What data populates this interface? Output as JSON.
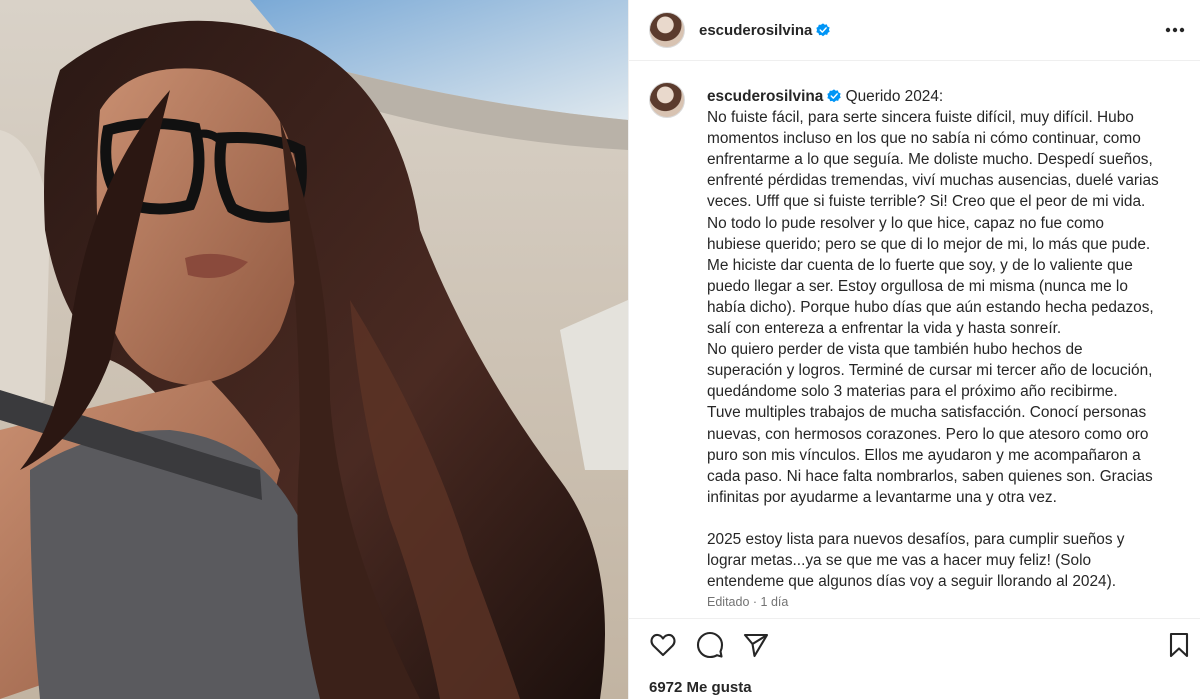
{
  "post": {
    "username": "escuderosilvina",
    "verified": true,
    "caption_lead": "Querido 2024:",
    "caption_body": "No fuiste fácil, para serte sincera fuiste difícil, muy difícil. Hubo\nmomentos incluso en los que no sabía ni cómo continuar, como\nenfrentarme a lo que seguía. Me doliste mucho. Despedí sueños,\nenfrenté pérdidas tremendas, viví muchas ausencias, duelé varias\nveces. Ufff que si fuiste terrible? Si! Creo que el peor de mi vida.\nNo todo lo pude resolver y lo que hice, capaz no fue como\nhubiese querido; pero se que di lo mejor de mi, lo más que pude.\nMe hiciste dar cuenta de lo fuerte que soy, y de lo valiente que\npuedo llegar a ser. Estoy orgullosa de mi misma (nunca me lo\nhabía dicho). Porque hubo días que aún estando hecha pedazos,\nsalí con entereza a enfrentar la vida y hasta sonreír.\nNo quiero perder de vista que también hubo hechos de\nsuperación y logros. Terminé de cursar mi tercer año de locución,\nquedándome solo 3 materias para el próximo año recibirme.\nTuve multiples trabajos de mucha satisfacción. Conocí personas\nnuevas, con hermosos corazones. Pero lo que atesoro como oro\npuro son mis vínculos. Ellos me ayudaron y me acompañaron a\ncada paso. Ni hace falta nombrarlos, saben quienes son. Gracias\ninfinitas por ayudarme a levantarme una y otra vez.\n\n2025 estoy lista para nuevos desafíos, para cumplir sueños y\nlograr metas...ya se que me vas a hacer muy feliz! (Solo\nentendeme que algunos días voy a seguir llorando al 2024).",
    "edited_label": "Editado",
    "separator": "·",
    "time_ago": "1 día",
    "likes_text": "6972 Me gusta"
  },
  "icons": {
    "more": "more-options-icon",
    "like": "heart-icon",
    "comment": "comment-icon",
    "share": "share-icon",
    "save": "bookmark-icon",
    "verified": "verified-badge-icon"
  },
  "colors": {
    "verified": "#0095f6",
    "text": "#262626",
    "muted": "#737373"
  }
}
